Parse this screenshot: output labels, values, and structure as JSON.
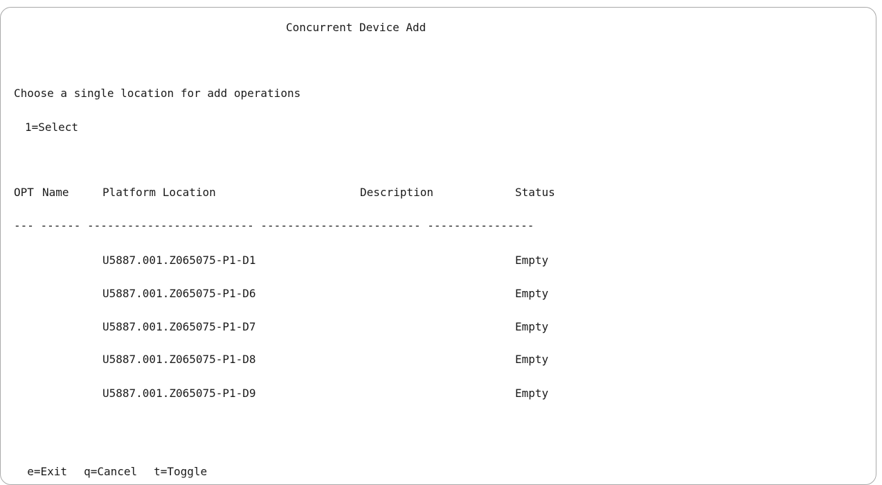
{
  "screen": {
    "title": "Concurrent Device Add",
    "instruction": "Choose a single location for add operations",
    "option_legend": "1=Select"
  },
  "table": {
    "headers": {
      "opt": "OPT",
      "name": "Name",
      "location": "Platform Location",
      "description": "Description",
      "status": "Status"
    },
    "divider": "--- ------ ------------------------- ------------------------ ----------------",
    "rows": [
      {
        "opt": "",
        "name": "",
        "location": "U5887.001.Z065075-P1-D1",
        "description": "",
        "status": "Empty"
      },
      {
        "opt": "",
        "name": "",
        "location": "U5887.001.Z065075-P1-D6",
        "description": "",
        "status": "Empty"
      },
      {
        "opt": "",
        "name": "",
        "location": "U5887.001.Z065075-P1-D7",
        "description": "",
        "status": "Empty"
      },
      {
        "opt": "",
        "name": "",
        "location": "U5887.001.Z065075-P1-D8",
        "description": "",
        "status": "Empty"
      },
      {
        "opt": "",
        "name": "",
        "location": "U5887.001.Z065075-P1-D9",
        "description": "",
        "status": "Empty"
      }
    ]
  },
  "function_keys": [
    {
      "label": "e=Exit"
    },
    {
      "label": "q=Cancel"
    },
    {
      "label": "t=Toggle"
    }
  ]
}
